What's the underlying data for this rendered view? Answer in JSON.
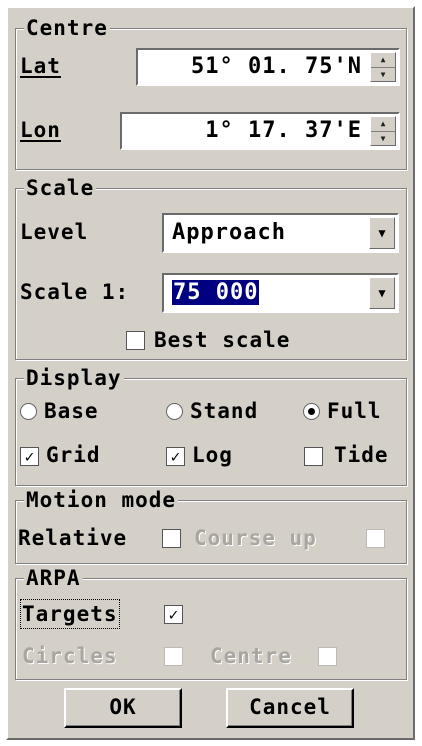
{
  "centre": {
    "title": "Centre",
    "lat_label": "Lat",
    "lat_value": "51° 01. 75'N",
    "lon_label": "Lon",
    "lon_value": "1° 17. 37'E"
  },
  "scale": {
    "title": "Scale",
    "level_label": "Level",
    "level_value": "Approach",
    "scale_label": "Scale 1:",
    "scale_value": "75 000",
    "best_scale_label": "Best scale",
    "best_scale_checked": false
  },
  "display": {
    "title": "Display",
    "radios": [
      {
        "label": "Base",
        "selected": false
      },
      {
        "label": "Stand",
        "selected": false
      },
      {
        "label": "Full",
        "selected": true
      }
    ],
    "checks": [
      {
        "label": "Grid",
        "checked": true
      },
      {
        "label": "Log",
        "checked": true
      },
      {
        "label": "Tide",
        "checked": false
      }
    ]
  },
  "motion": {
    "title": "Motion mode",
    "relative_label": "Relative",
    "relative_checked": false,
    "course_up_label": "Course up",
    "course_up_checked": false
  },
  "arpa": {
    "title": "ARPA",
    "targets_label": "Targets",
    "targets_checked": true,
    "circles_label": "Circles",
    "circles_checked": false,
    "centre_label": "Centre",
    "centre_checked": false
  },
  "buttons": {
    "ok": "OK",
    "cancel": "Cancel"
  },
  "icons": {
    "check_mark": "✓",
    "spin_up": "▲",
    "spin_down": "▼",
    "dropdown": "▼"
  }
}
